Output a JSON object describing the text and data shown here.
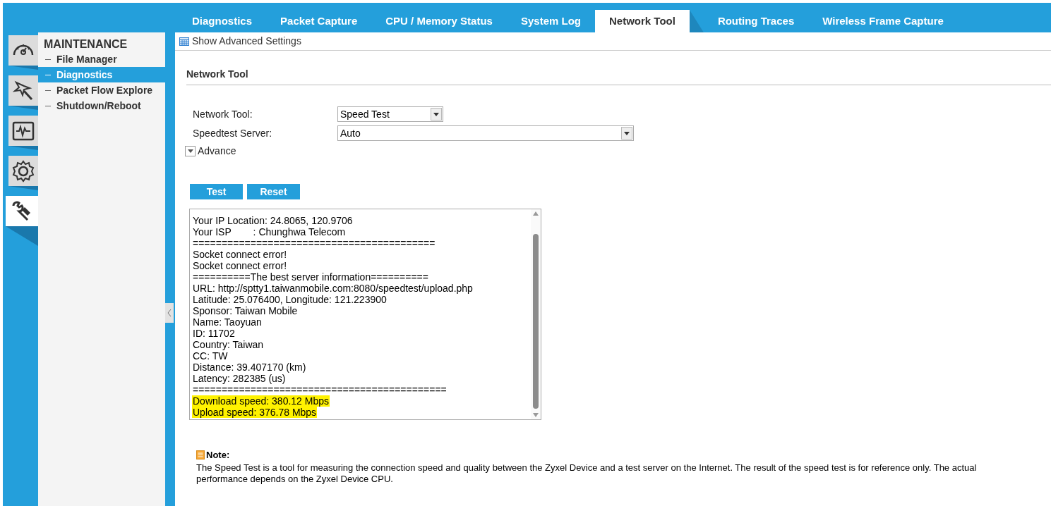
{
  "tabs": [
    {
      "label": "Diagnostics",
      "selected": false
    },
    {
      "label": "Packet Capture",
      "selected": false
    },
    {
      "label": "CPU / Memory Status",
      "selected": false
    },
    {
      "label": "System Log",
      "selected": false
    },
    {
      "label": "Network Tool",
      "selected": true
    },
    {
      "label": "Routing Traces",
      "selected": false
    },
    {
      "label": "Wireless Frame Capture",
      "selected": false
    }
  ],
  "icon_rail": [
    {
      "kind": "dashboard",
      "selected": false
    },
    {
      "kind": "wizard",
      "selected": false
    },
    {
      "kind": "monitor",
      "selected": false
    },
    {
      "kind": "settings",
      "selected": false
    },
    {
      "kind": "maintenance",
      "selected": true
    }
  ],
  "sidebar": {
    "title": "MAINTENANCE",
    "items": [
      {
        "label": "File Manager",
        "selected": false
      },
      {
        "label": "Diagnostics",
        "selected": true
      },
      {
        "label": "Packet Flow Explore",
        "selected": false
      },
      {
        "label": "Shutdown/Reboot",
        "selected": false
      }
    ]
  },
  "toolbar": {
    "label": "Show Advanced Settings"
  },
  "section_title": "Network Tool",
  "form": [
    {
      "label": "Network Tool:",
      "value": "Speed Test",
      "wide": false
    },
    {
      "label": "Speedtest Server:",
      "value": "Auto",
      "wide": true
    }
  ],
  "advance": {
    "label": "Advance",
    "expanded": false
  },
  "buttons": [
    "Test",
    "Reset"
  ],
  "output_lines": [
    {
      "text": "Your IP Location: 24.8065, 120.9706",
      "highlighted": false
    },
    {
      "text": "Your ISP        : Chunghwa Telecom",
      "highlighted": false
    },
    {
      "text": "==========================================",
      "highlighted": false
    },
    {
      "text": "Socket connect error!",
      "highlighted": false
    },
    {
      "text": "Socket connect error!",
      "highlighted": false
    },
    {
      "text": "==========The best server information==========",
      "highlighted": false
    },
    {
      "text": "URL: http://sptty1.taiwanmobile.com:8080/speedtest/upload.php",
      "highlighted": false
    },
    {
      "text": "Latitude: 25.076400, Longitude: 121.223900",
      "highlighted": false
    },
    {
      "text": "Sponsor: Taiwan Mobile",
      "highlighted": false
    },
    {
      "text": "Name: Taoyuan",
      "highlighted": false
    },
    {
      "text": "ID: 11702",
      "highlighted": false
    },
    {
      "text": "Country: Taiwan",
      "highlighted": false
    },
    {
      "text": "CC: TW",
      "highlighted": false
    },
    {
      "text": "Distance: 39.407170 (km)",
      "highlighted": false
    },
    {
      "text": "Latency: 282385 (us)",
      "highlighted": false
    },
    {
      "text": "============================================",
      "highlighted": false
    },
    {
      "text": "Download speed: 380.12 Mbps",
      "highlighted": true
    },
    {
      "text": "Upload speed: 376.78 Mbps",
      "highlighted": true
    }
  ],
  "note": {
    "title": "Note:",
    "text": "The Speed Test is a tool for measuring the connection speed and quality between the Zyxel Device and a test server on the Internet. The result of the speed test is for reference only. The actual performance depends on the Zyxel Device CPU."
  }
}
